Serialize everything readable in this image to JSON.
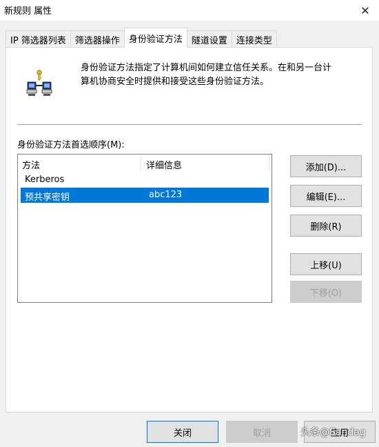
{
  "window": {
    "title": "新规则 属性",
    "close_glyph": "✕"
  },
  "tabs": [
    {
      "label": "IP 筛选器列表",
      "active": false
    },
    {
      "label": "筛选器操作",
      "active": false
    },
    {
      "label": "身份验证方法",
      "active": true
    },
    {
      "label": "隧道设置",
      "active": false
    },
    {
      "label": "连接类型",
      "active": false
    }
  ],
  "panel": {
    "icon": "network-computers-key-icon",
    "description_line1": "身份验证方法指定了计算机间如何建立信任关系。在和另一台计",
    "description_line2": "算机协商安全时提供和接受这些身份验证方法。",
    "list_label": "身份验证方法首选顺序(M):",
    "columns": [
      "方法",
      "详细信息"
    ],
    "rows": [
      {
        "method": "Kerberos",
        "details": "",
        "selected": false
      },
      {
        "method": "预共享密钥",
        "details": "abc123",
        "selected": true
      }
    ]
  },
  "side_buttons": {
    "add": "添加(D)...",
    "edit": "编辑(E)...",
    "delete": "删除(R)",
    "move_up": "上移(U)",
    "move_down": "下移(O)"
  },
  "footer": {
    "close": "关闭",
    "cancel": "取消",
    "apply": "应用",
    "watermark": "头条@Sandag"
  },
  "colors": {
    "selection": "#0078d7",
    "focus_border": "#0078d7"
  }
}
